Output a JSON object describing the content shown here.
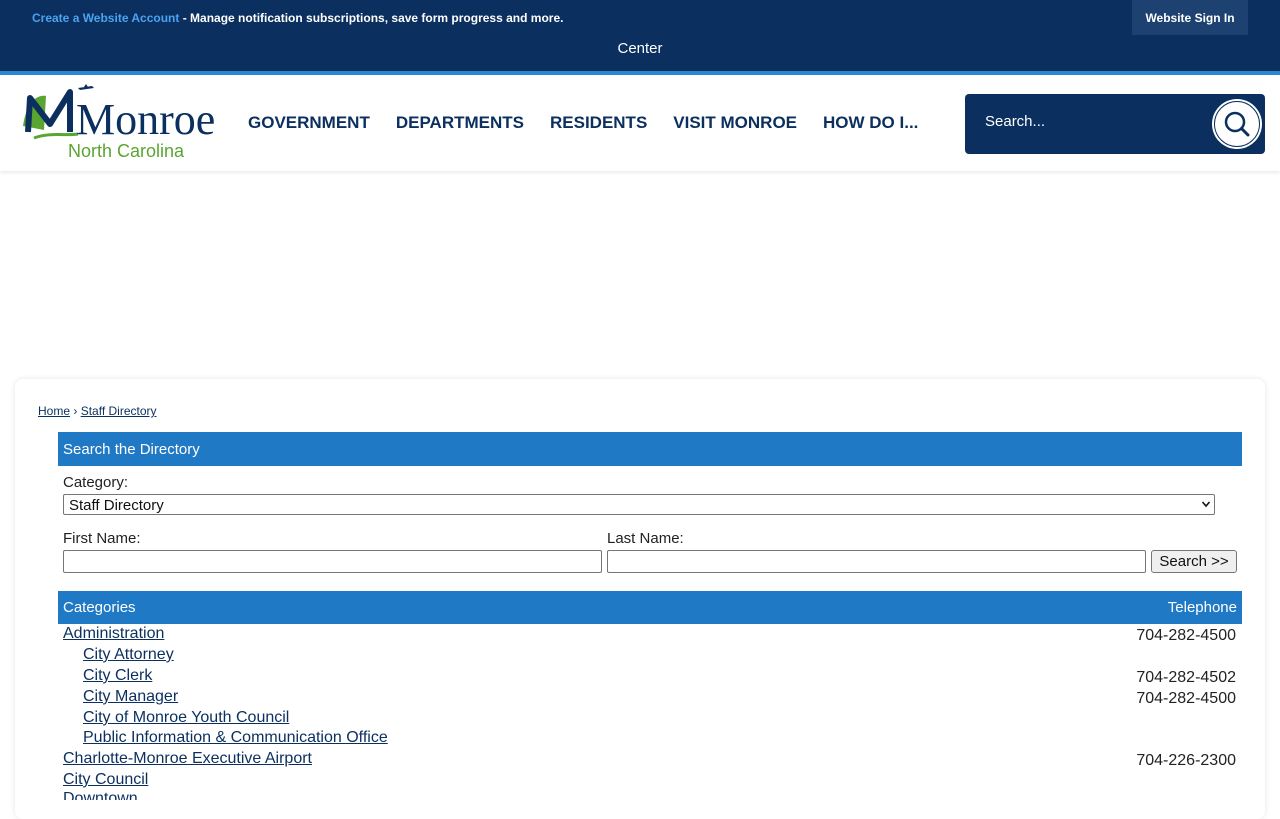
{
  "topbar": {
    "create_account_link": "Create a Website Account",
    "message": " - Manage notification subscriptions, save form progress and more.",
    "sign_in": "Website Sign In"
  },
  "strip": {
    "text": "Center"
  },
  "header": {
    "logo_text_main": "Monroe",
    "logo_text_sub": "North Carolina",
    "nav": [
      "GOVERNMENT",
      "DEPARTMENTS",
      "RESIDENTS",
      "VISIT MONROE",
      "HOW DO I..."
    ],
    "search_placeholder": "Search..."
  },
  "breadcrumb": {
    "home": "Home",
    "separator": " › ",
    "current": "Staff Directory"
  },
  "search_panel": {
    "title": "Search the Directory",
    "category_label": "Category:",
    "category_value": "Staff Directory",
    "first_name_label": "First Name:",
    "last_name_label": "Last Name:",
    "first_name_value": "",
    "last_name_value": "",
    "search_button": "Search >>"
  },
  "directory": {
    "col_categories": "Categories",
    "col_telephone": "Telephone",
    "rows": [
      {
        "name": "Administration",
        "phone": "704-282-4500",
        "indent": 0
      },
      {
        "name": "City Attorney",
        "phone": "",
        "indent": 1
      },
      {
        "name": "City Clerk",
        "phone": "704-282-4502",
        "indent": 1
      },
      {
        "name": "City Manager",
        "phone": "704-282-4500",
        "indent": 1
      },
      {
        "name": "City of Monroe Youth Council",
        "phone": "",
        "indent": 1
      },
      {
        "name": "Public Information & Communication Office",
        "phone": "",
        "indent": 1
      },
      {
        "name": "Charlotte-Monroe Executive Airport",
        "phone": "704-226-2300",
        "indent": 0
      },
      {
        "name": "City Council",
        "phone": "",
        "indent": 0
      },
      {
        "name": "Downtown",
        "phone": "",
        "indent": 0
      }
    ]
  },
  "colors": {
    "navy": "#0b2f5e",
    "blue": "#1f79c4",
    "accent_line": "#2d86d4",
    "logo_green": "#5aa532"
  },
  "icons": {
    "search": "magnifier-icon",
    "select": "chevron-down-icon",
    "logo_plane": "airplane-icon"
  }
}
